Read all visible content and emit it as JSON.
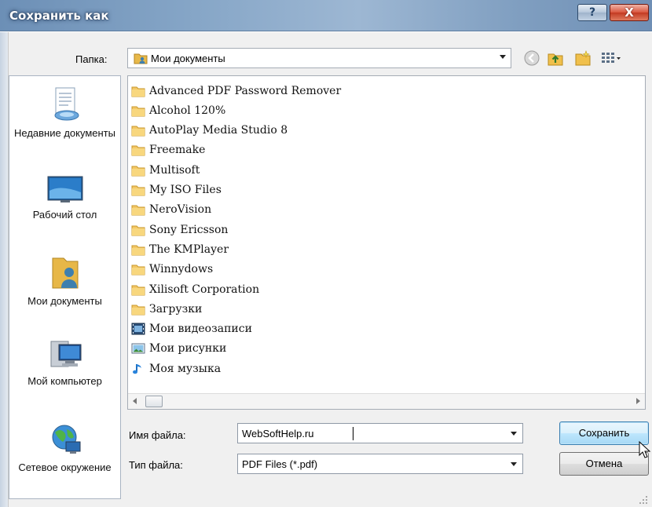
{
  "window": {
    "title": "Сохранить как",
    "help_glyph": "?",
    "close_glyph": "X"
  },
  "location": {
    "label": "Папка:",
    "current_folder": "Мои документы"
  },
  "places": [
    {
      "label": "Недавние документы",
      "icon": "recent-documents-icon"
    },
    {
      "label": "Рабочий стол",
      "icon": "desktop-icon"
    },
    {
      "label": "Мои документы",
      "icon": "my-documents-icon"
    },
    {
      "label": "Мой компьютер",
      "icon": "my-computer-icon"
    },
    {
      "label": "Сетевое окружение",
      "icon": "network-icon"
    }
  ],
  "files": [
    {
      "name": "Advanced PDF Password Remover",
      "icon": "folder-icon"
    },
    {
      "name": "Alcohol 120%",
      "icon": "folder-icon"
    },
    {
      "name": "AutoPlay Media Studio 8",
      "icon": "folder-icon"
    },
    {
      "name": "Freemake",
      "icon": "folder-icon"
    },
    {
      "name": "Multisoft",
      "icon": "folder-icon"
    },
    {
      "name": "My ISO Files",
      "icon": "folder-icon"
    },
    {
      "name": "NeroVision",
      "icon": "folder-icon"
    },
    {
      "name": "Sony Ericsson",
      "icon": "folder-icon"
    },
    {
      "name": "The KMPlayer",
      "icon": "folder-icon"
    },
    {
      "name": "Winnydows",
      "icon": "folder-icon"
    },
    {
      "name": "Xilisoft Corporation",
      "icon": "folder-icon"
    },
    {
      "name": "Загрузки",
      "icon": "folder-icon"
    },
    {
      "name": "Мои видеозаписи",
      "icon": "videos-folder-icon"
    },
    {
      "name": "Мои рисунки",
      "icon": "pictures-folder-icon"
    },
    {
      "name": "Моя музыка",
      "icon": "music-folder-icon"
    }
  ],
  "form": {
    "filename_label": "Имя файла:",
    "filename_value": "WebSoftHelp.ru",
    "filetype_label": "Тип файла:",
    "filetype_value": "PDF Files (*.pdf)"
  },
  "buttons": {
    "save": "Сохранить",
    "cancel": "Отмена"
  },
  "colors": {
    "title_bar": "#86a6c7",
    "default_button": "#bee6fd",
    "close_button": "#c23a22",
    "folder": "#f3c766"
  }
}
